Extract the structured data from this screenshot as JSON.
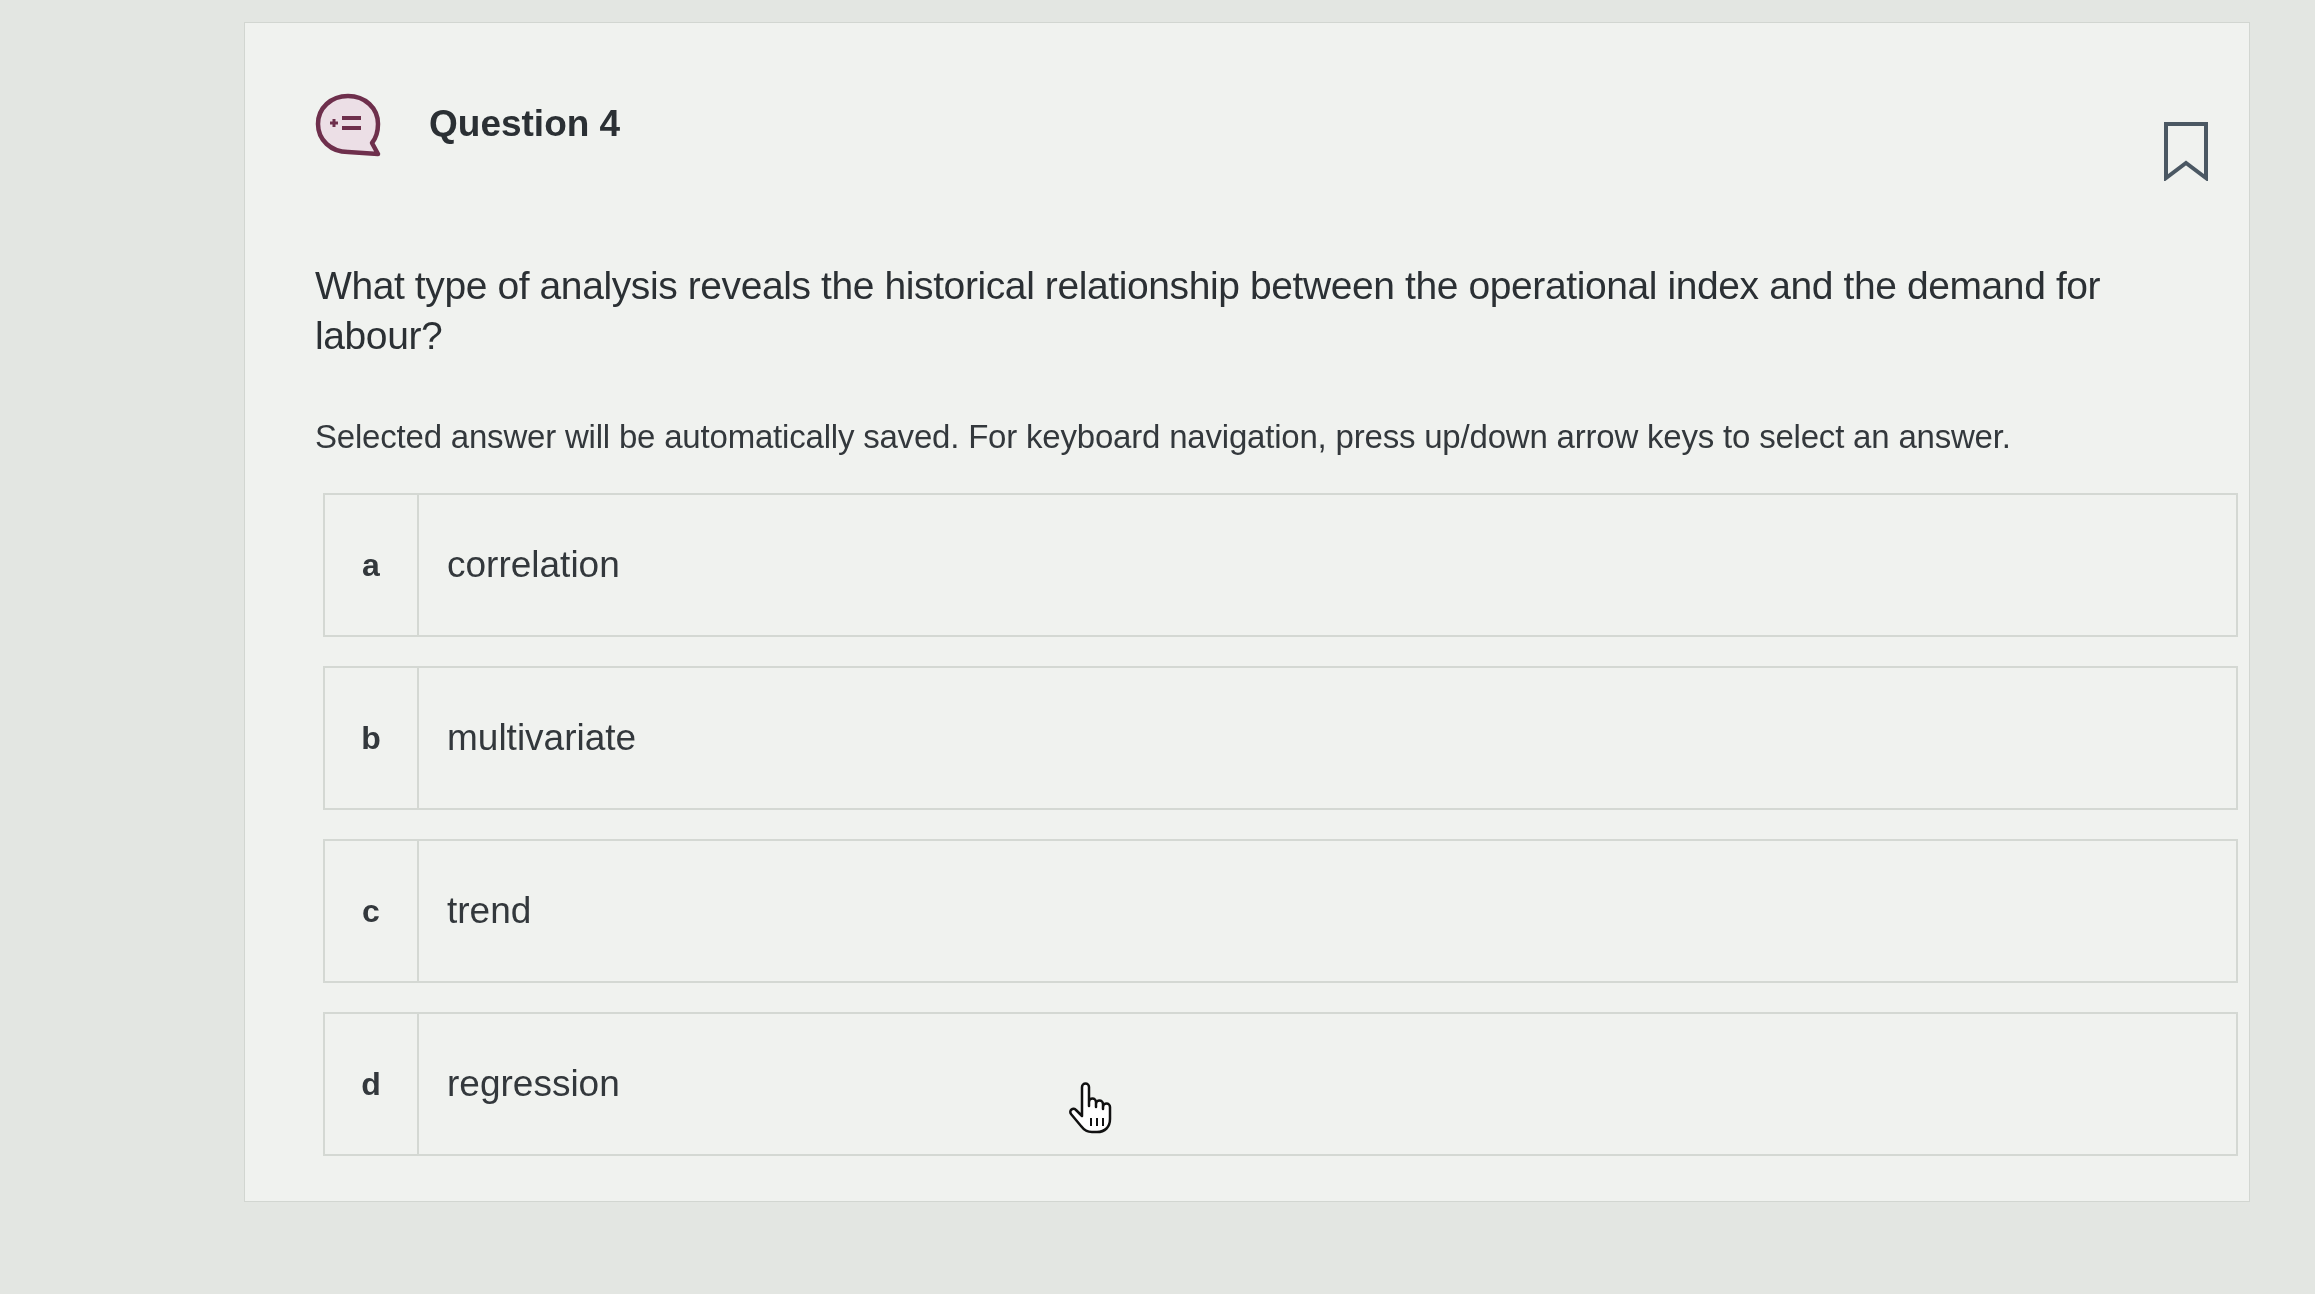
{
  "question": {
    "title": "Question 4",
    "text": "What type of analysis reveals the historical relationship between the operational index and the demand for labour?",
    "instructions": "Selected answer will be automatically saved. For keyboard navigation, press up/down arrow keys to select an answer."
  },
  "options": [
    {
      "letter": "a",
      "label": "correlation",
      "selected": false
    },
    {
      "letter": "b",
      "label": "multivariate",
      "selected": false
    },
    {
      "letter": "c",
      "label": "trend",
      "selected": false
    },
    {
      "letter": "d",
      "label": "regression",
      "selected": false
    }
  ]
}
